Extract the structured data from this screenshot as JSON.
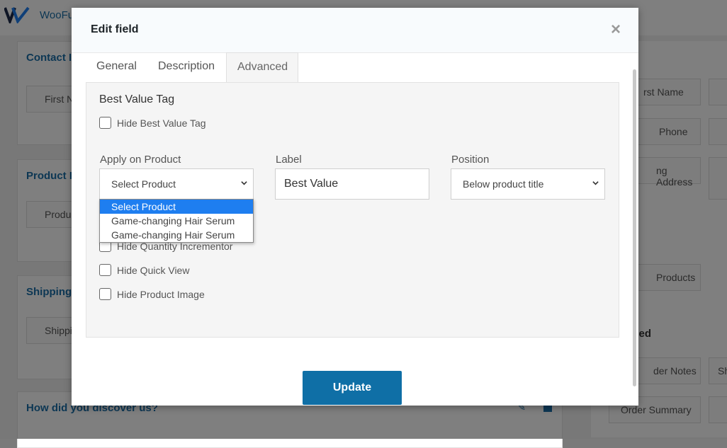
{
  "background": {
    "brand": "WooFu",
    "sections": [
      "Contact In",
      "Product D",
      "Shipping",
      "How did you discover us?"
    ],
    "left_fields": [
      "First N",
      "Produc",
      "Shippi"
    ],
    "right_fields": [
      "rst Name",
      "Phone",
      "ng Address",
      "Products",
      "der Notes",
      "Sh",
      "Order Summary"
    ],
    "right_titles": [
      "ct",
      "nced"
    ]
  },
  "modal": {
    "title": "Edit field",
    "close_symbol": "×",
    "tabs": [
      "General",
      "Description",
      "Advanced"
    ],
    "active_tab": "Advanced",
    "section_title": "Best Value Tag",
    "hide_best_value_tag": "Hide Best Value Tag",
    "apply_label": "Apply on Product",
    "apply_value": "Select Product",
    "label_label": "Label",
    "label_value": "Best Value",
    "position_label": "Position",
    "position_value": "Below product title",
    "dropdown_options": [
      "Select Product",
      "Game-changing Hair Serum",
      "Game-changing Hair Serum"
    ],
    "dropdown_selected": "Select Product",
    "checkboxes": [
      "Hide Quantity Incrementor",
      "Hide Quick View",
      "Hide Product Image"
    ],
    "update_button": "Update"
  },
  "colors": {
    "accent": "#0f6fa6",
    "link": "#1a6fa8",
    "highlight": "#1e7ef0"
  }
}
